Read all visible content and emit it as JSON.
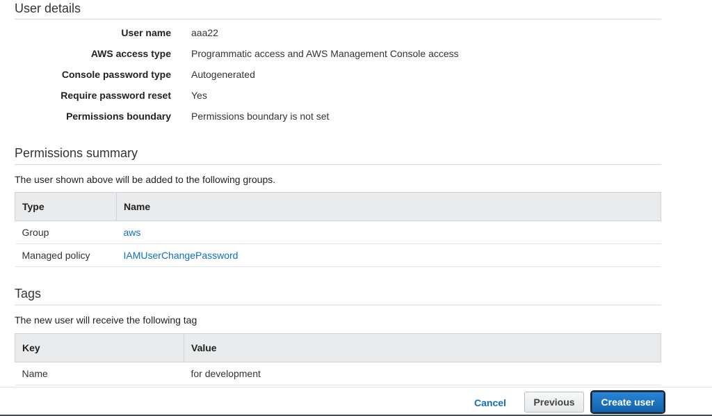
{
  "user_details": {
    "title": "User details",
    "rows": [
      {
        "label": "User name",
        "value": "aaa22"
      },
      {
        "label": "AWS access type",
        "value": "Programmatic access and AWS Management Console access"
      },
      {
        "label": "Console password type",
        "value": "Autogenerated"
      },
      {
        "label": "Require password reset",
        "value": "Yes"
      },
      {
        "label": "Permissions boundary",
        "value": "Permissions boundary is not set"
      }
    ]
  },
  "permissions": {
    "title": "Permissions summary",
    "description": "The user shown above will be added to the following groups.",
    "columns": [
      "Type",
      "Name"
    ],
    "rows": [
      {
        "type": "Group",
        "name": "aws"
      },
      {
        "type": "Managed policy",
        "name": "IAMUserChangePassword"
      }
    ]
  },
  "tags": {
    "title": "Tags",
    "description": "The new user will receive the following tag",
    "columns": [
      "Key",
      "Value"
    ],
    "rows": [
      {
        "key": "Name",
        "value": "for development"
      }
    ]
  },
  "footer": {
    "cancel_label": "Cancel",
    "previous_label": "Previous",
    "create_label": "Create user"
  },
  "colors": {
    "link": "#0e6fbf",
    "primary_button": "#1a6fc0",
    "table_header_bg": "#e9ebed"
  }
}
